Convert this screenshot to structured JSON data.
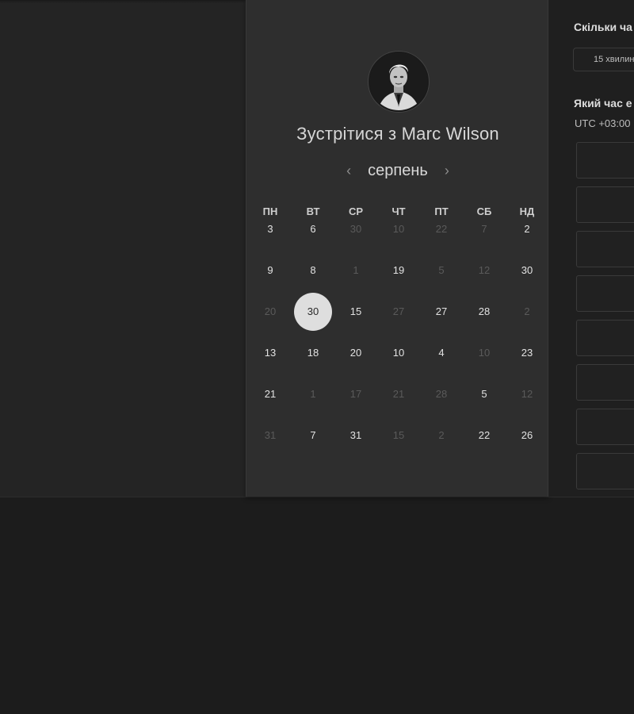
{
  "scheduler": {
    "title": "Зустрітися з Marc Wilson",
    "month": "серпень",
    "weekdays": [
      "ПН",
      "ВТ",
      "СР",
      "ЧТ",
      "ПТ",
      "СБ",
      "НД"
    ],
    "weeks": [
      [
        {
          "d": "3",
          "s": "on"
        },
        {
          "d": "6",
          "s": "on"
        },
        {
          "d": "30",
          "s": "off"
        },
        {
          "d": "10",
          "s": "off"
        },
        {
          "d": "22",
          "s": "off"
        },
        {
          "d": "7",
          "s": "off"
        },
        {
          "d": "2",
          "s": "on"
        }
      ],
      [
        {
          "d": "9",
          "s": "on"
        },
        {
          "d": "8",
          "s": "on"
        },
        {
          "d": "1",
          "s": "off"
        },
        {
          "d": "19",
          "s": "on"
        },
        {
          "d": "5",
          "s": "off"
        },
        {
          "d": "12",
          "s": "off"
        },
        {
          "d": "30",
          "s": "on"
        }
      ],
      [
        {
          "d": "20",
          "s": "off"
        },
        {
          "d": "30",
          "s": "selected"
        },
        {
          "d": "15",
          "s": "on"
        },
        {
          "d": "27",
          "s": "off"
        },
        {
          "d": "27",
          "s": "on"
        },
        {
          "d": "28",
          "s": "on"
        },
        {
          "d": "2",
          "s": "off"
        }
      ],
      [
        {
          "d": "13",
          "s": "on"
        },
        {
          "d": "18",
          "s": "on"
        },
        {
          "d": "20",
          "s": "on"
        },
        {
          "d": "10",
          "s": "on"
        },
        {
          "d": "4",
          "s": "on"
        },
        {
          "d": "10",
          "s": "off"
        },
        {
          "d": "23",
          "s": "on"
        }
      ],
      [
        {
          "d": "21",
          "s": "on"
        },
        {
          "d": "1",
          "s": "off"
        },
        {
          "d": "17",
          "s": "off"
        },
        {
          "d": "21",
          "s": "off"
        },
        {
          "d": "28",
          "s": "off"
        },
        {
          "d": "5",
          "s": "on"
        },
        {
          "d": "12",
          "s": "off"
        }
      ],
      [
        {
          "d": "31",
          "s": "off"
        },
        {
          "d": "7",
          "s": "on"
        },
        {
          "d": "31",
          "s": "on"
        },
        {
          "d": "15",
          "s": "off"
        },
        {
          "d": "2",
          "s": "off"
        },
        {
          "d": "22",
          "s": "on"
        },
        {
          "d": "26",
          "s": "on"
        }
      ]
    ],
    "prev_icon": "chevron-left-icon",
    "next_icon": "chevron-right-icon"
  },
  "side": {
    "duration_question": "Скільки ча",
    "duration_value": "15 хвилин",
    "time_question": "Який час е",
    "timezone": "UTC +03:00"
  },
  "colors": {
    "page_bg": "#1c1c1c",
    "card_bg": "#2e2e2e",
    "selected_day": "#dedede"
  }
}
